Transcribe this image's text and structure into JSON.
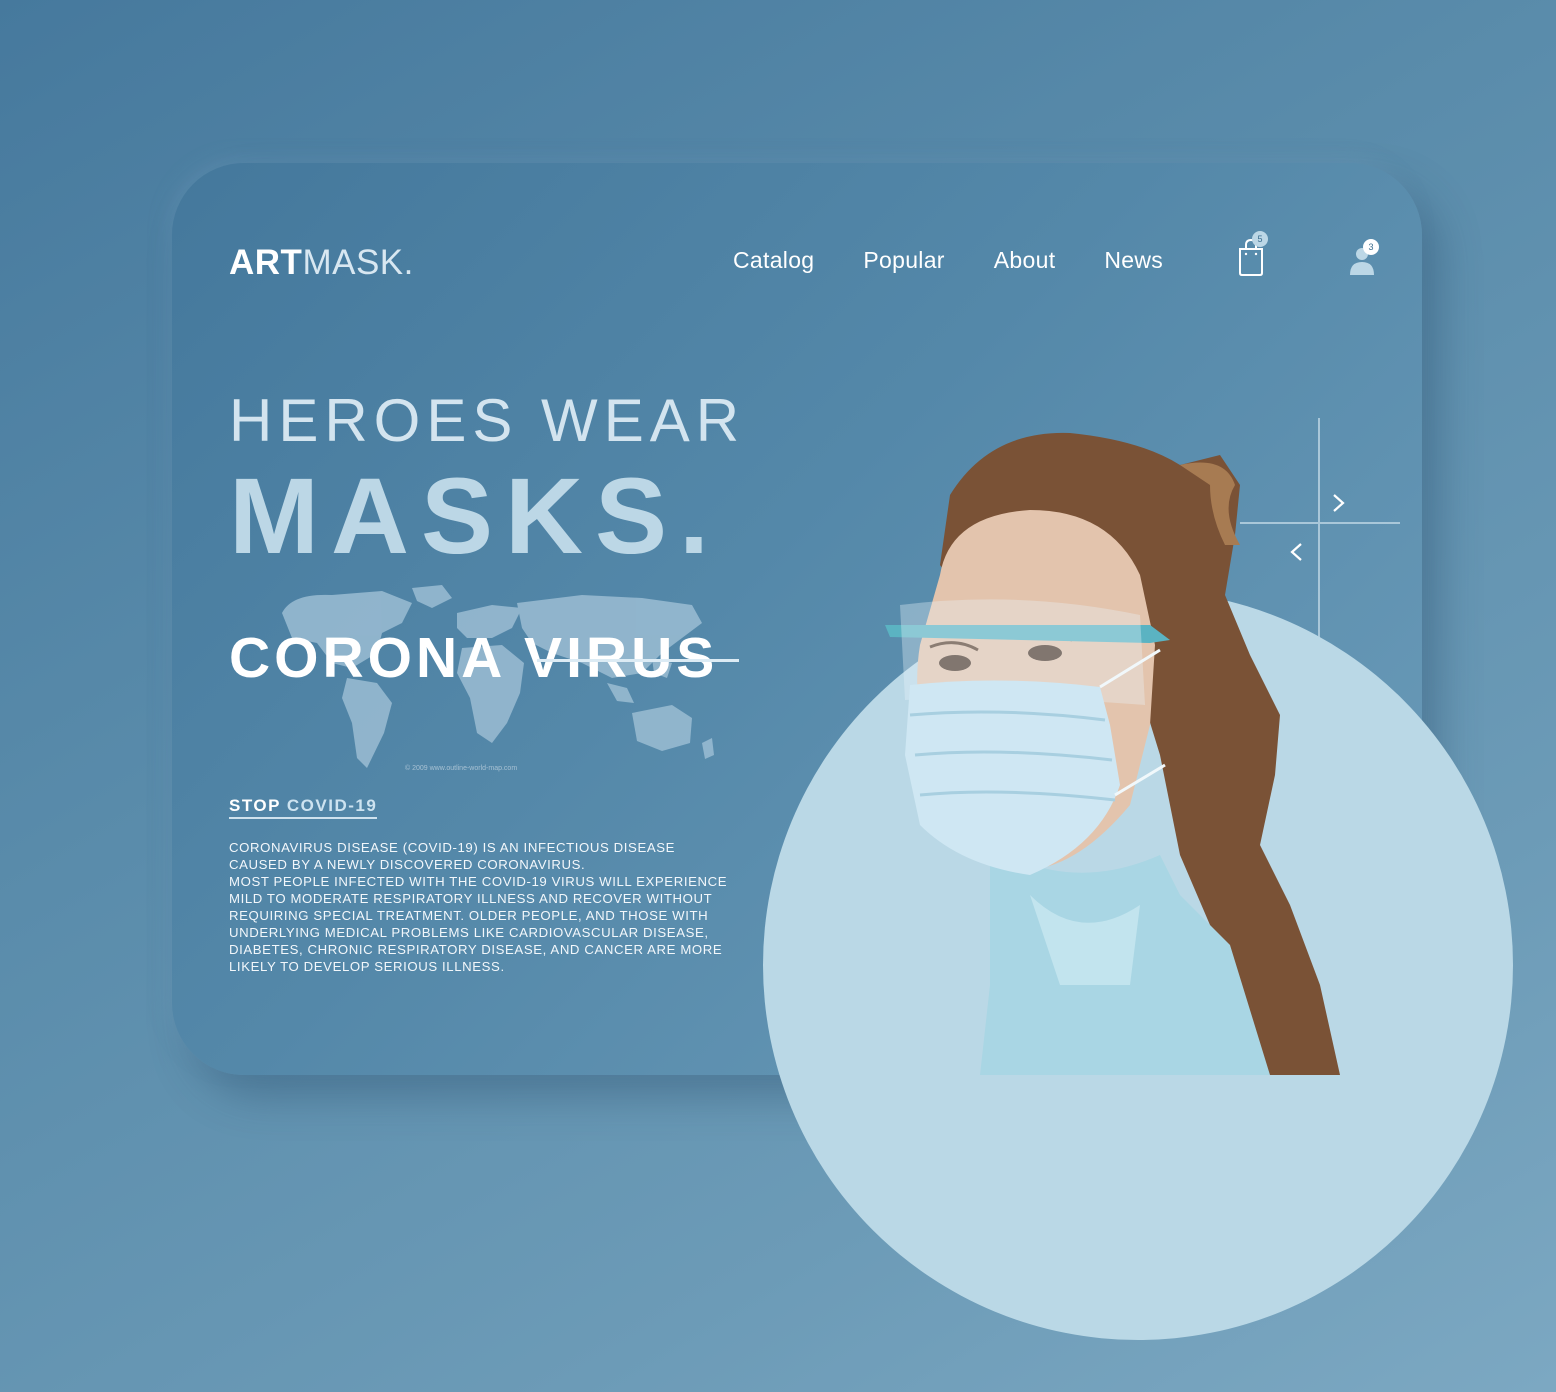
{
  "brand": {
    "bold": "ART",
    "light": "MASK."
  },
  "nav": {
    "items": [
      "Catalog",
      "Popular",
      "About",
      "News"
    ]
  },
  "cart": {
    "icon": "shopping-bag-icon",
    "count": "5"
  },
  "account": {
    "icon": "user-icon",
    "count": "3"
  },
  "hero": {
    "subtitle": "HEROES WEAR",
    "title": "MASKS.",
    "headline": "CORONA VIRUS",
    "map_credit": "© 2009 www.outline-world-map.com"
  },
  "cta": {
    "stop": "STOP",
    "covid": "COVID-19"
  },
  "description": {
    "paragraph1": "CORONAVIRUS DISEASE (COVID-19) IS AN INFECTIOUS DISEASE CAUSED BY A NEWLY DISCOVERED CORONAVIRUS.",
    "paragraph2": "MOST PEOPLE INFECTED WITH THE COVID-19 VIRUS WILL EXPERIENCE MILD TO MODERATE RESPIRATORY ILLNESS AND RECOVER WITHOUT REQUIRING SPECIAL TREATMENT.  OLDER PEOPLE, AND THOSE WITH UNDERLYING MEDICAL PROBLEMS LIKE CARDIOVASCULAR DISEASE, DIABETES, CHRONIC RESPIRATORY DISEASE, AND CANCER ARE MORE LIKELY TO DEVELOP SERIOUS ILLNESS."
  },
  "slider": {
    "next_icon": "chevron-right-icon",
    "prev_icon": "chevron-left-icon"
  },
  "colors": {
    "background": "#5a8cab",
    "card": "#5488a9",
    "accent_light": "#bad8e6",
    "text": "#ffffff"
  }
}
